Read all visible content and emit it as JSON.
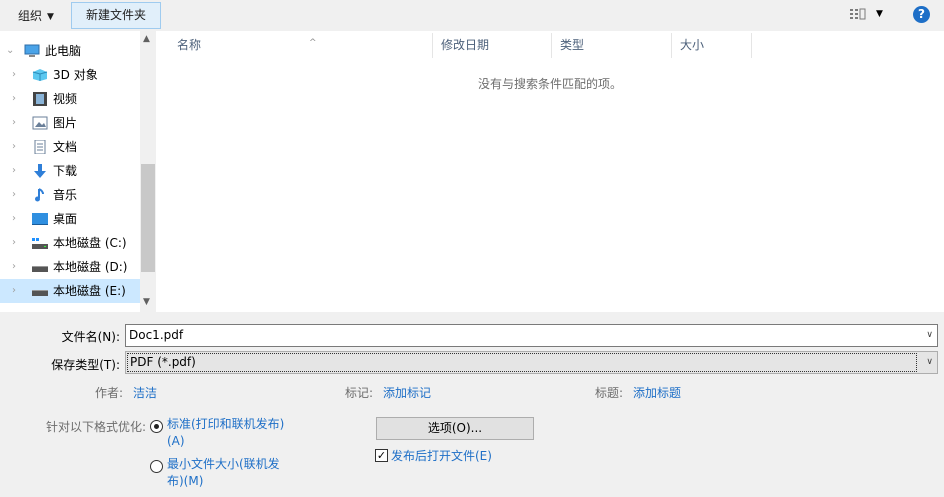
{
  "toolbar": {
    "organize_label": "组织",
    "new_folder_label": "新建文件夹",
    "help_label": "?"
  },
  "nav": {
    "items": [
      {
        "label": "此电脑",
        "icon": "computer-icon"
      },
      {
        "label": "3D 对象",
        "icon": "3d-objects-icon"
      },
      {
        "label": "视频",
        "icon": "video-icon"
      },
      {
        "label": "图片",
        "icon": "pictures-icon"
      },
      {
        "label": "文档",
        "icon": "documents-icon"
      },
      {
        "label": "下载",
        "icon": "download-icon"
      },
      {
        "label": "音乐",
        "icon": "music-icon"
      },
      {
        "label": "桌面",
        "icon": "desktop-icon"
      },
      {
        "label": "本地磁盘 (C:)",
        "icon": "drive-c-icon"
      },
      {
        "label": "本地磁盘 (D:)",
        "icon": "drive-d-icon"
      },
      {
        "label": "本地磁盘 (E:)",
        "icon": "drive-e-icon"
      }
    ],
    "selected": "本地磁盘 (E:)"
  },
  "list": {
    "columns": [
      "名称",
      "修改日期",
      "类型",
      "大小"
    ],
    "empty_message": "没有与搜索条件匹配的项。"
  },
  "form": {
    "filename_label": "文件名(N):",
    "filename_value": "Doc1.pdf",
    "filetype_label": "保存类型(T):",
    "filetype_value": "PDF (*.pdf)",
    "author_label": "作者:",
    "author_value": "洁洁",
    "tags_label": "标记:",
    "tags_value": "添加标记",
    "title_label": "标题:",
    "title_value": "添加标题",
    "optimize_label": "针对以下格式优化:",
    "radio_standard_line1": "标准(打印和联机发布)",
    "radio_standard_line2": "(A)",
    "radio_min_line1": "最小文件大小(联机发",
    "radio_min_line2": "布)(M)",
    "options_button": "选项(O)...",
    "open_after_publish": "发布后打开文件(E)"
  },
  "colors": {
    "accent": "#1e6fc7",
    "selection": "#cce8ff",
    "new_folder_bg": "#e1effa"
  }
}
